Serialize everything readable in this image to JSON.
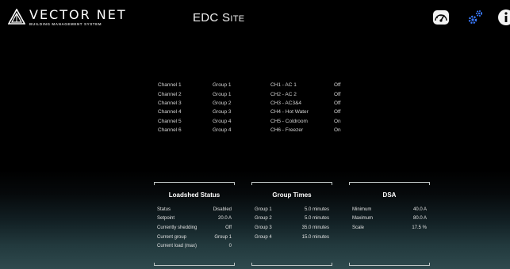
{
  "header": {
    "logo_name": "VECTOR NET",
    "logo_tagline": "BUILDING MANAGEMENT SYSTEM",
    "site_title": "EDC Site",
    "icons": [
      "gauge-icon",
      "gears-icon",
      "info-icon"
    ]
  },
  "channels": [
    {
      "name": "Channel 1",
      "group": "Group 1",
      "label": "CH1 - AC 1",
      "state": "Off"
    },
    {
      "name": "Channel 2",
      "group": "Group 1",
      "label": "CH2 - AC 2",
      "state": "Off"
    },
    {
      "name": "Channel 3",
      "group": "Group 2",
      "label": "CH3 - AC3&4",
      "state": "Off"
    },
    {
      "name": "Channel 4",
      "group": "Group 3",
      "label": "CH4 - Hot Water",
      "state": "Off"
    },
    {
      "name": "Channel 5",
      "group": "Group 4",
      "label": "CH5 - Coldroom",
      "state": "On"
    },
    {
      "name": "Channel 6",
      "group": "Group 4",
      "label": "CH6 - Freezer",
      "state": "On"
    }
  ],
  "loadshed": {
    "title": "Loadshed Status",
    "rows": [
      {
        "label": "Status",
        "value": "Disabled"
      },
      {
        "label": "Setpoint",
        "value": "20.0 A"
      },
      {
        "label": "Currently shedding",
        "value": "Off"
      },
      {
        "label": "Current group",
        "value": "Group 1"
      },
      {
        "label": "Current load (max)",
        "value": "0"
      }
    ]
  },
  "group_times": {
    "title": "Group Times",
    "rows": [
      {
        "label": "Group 1",
        "value": "5.0 minutes"
      },
      {
        "label": "Group 2",
        "value": "5.0 minutes"
      },
      {
        "label": "Group 3",
        "value": "35.0 minutes"
      },
      {
        "label": "Group 4",
        "value": "15.0 minutes"
      }
    ]
  },
  "dsa": {
    "title": "DSA",
    "rows": [
      {
        "label": "Minimum",
        "value": "40.0 A"
      },
      {
        "label": "Maximum",
        "value": "80.0 A"
      },
      {
        "label": "Scale",
        "value": "17.5 %"
      }
    ]
  },
  "colors": {
    "background_top": "#000000",
    "background_bottom": "#2f4a4e",
    "gears_icon": "#3a7bff",
    "text": "#e8e8e8"
  }
}
